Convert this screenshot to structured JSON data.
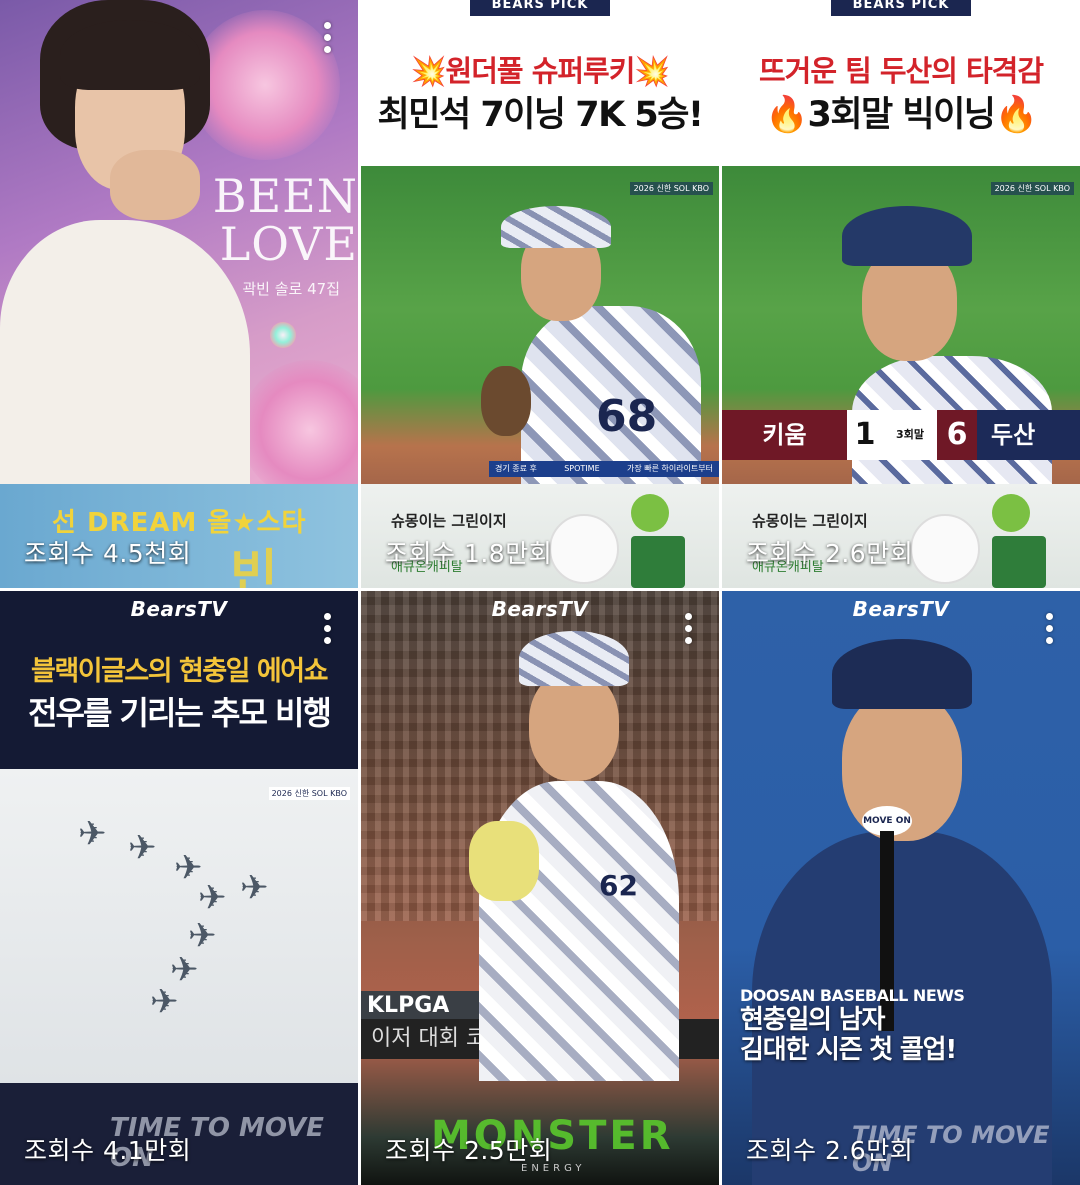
{
  "videos": [
    {
      "views": "조회수 4.5천회",
      "poster_title": "BEEN\nLOVE",
      "poster_sub": "곽빈 솔로 47집",
      "banner_text": "선 DREAM 올★스타",
      "banner_big": "빈"
    },
    {
      "views": "조회수 1.8만회",
      "badge": "BEARS PICK",
      "headline1": "💥원더풀 슈퍼루키💥",
      "headline2": "최민석 7이닝 7K 5승!",
      "jersey_number": "68",
      "broadcast": "2026 신한 SOL KBO",
      "ticker": [
        "경기 종료 후",
        "SPOTIME",
        "가장 빠른 하이라이트부터"
      ],
      "ad_line1": "슈몽이는 그린이지",
      "ad_line2": "애큐온캐피탈"
    },
    {
      "views": "조회수 2.6만회",
      "badge": "BEARS PICK",
      "headline1": "뜨거운 팀 두산의 타격감",
      "headline2": "🔥3회말 빅이닝🔥",
      "broadcast": "2026 신한 SOL KBO",
      "score": {
        "team1": "키움",
        "score1": "1",
        "inning": "3회말",
        "score2": "6",
        "team2": "두산"
      },
      "ad_line1": "슈몽이는 그린이지",
      "ad_line2": "애큐온캐피탈"
    },
    {
      "views": "조회수 4.1만회",
      "logo": "BearsTV",
      "headline1": "블랙이글스의 현충일 에어쇼",
      "headline2": "전우를 기리는 추모 비행",
      "broadcast": "2026 신한 SOL KBO",
      "bottom_text": "TIME TO MOVE ON"
    },
    {
      "views": "조회수 2.5만회",
      "logo": "BearsTV",
      "jersey_number": "62",
      "board_left": "KLPGA",
      "board_text": "이저 대회 코",
      "sponsor": "MONSTER",
      "sponsor_sub": "ENERGY"
    },
    {
      "views": "조회수 2.6만회",
      "logo": "BearsTV",
      "news_label": "DOOSAN BASEBALL NEWS",
      "headline1": "현충일의 남자",
      "headline2": "김대한 시즌 첫 콜업!",
      "mic_text": "MOVE ON",
      "bottom_text": "TIME TO MOVE ON"
    }
  ],
  "icons": {
    "more": "more-vertical-icon",
    "jet": "jet-icon"
  }
}
